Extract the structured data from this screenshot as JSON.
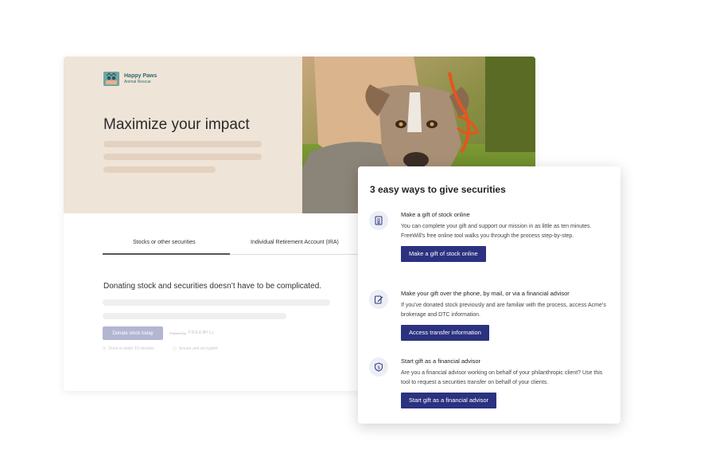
{
  "brand": {
    "name": "Happy Paws",
    "tagline": "Animal Rescue"
  },
  "hero": {
    "title": "Maximize your impact"
  },
  "tabs": [
    {
      "label": "Stocks or other securities",
      "active": true
    },
    {
      "label": "Individual Retirement Account (IRA)",
      "active": false
    }
  ],
  "main": {
    "lead": "Donating stock and securities doesn’t have to be complicated.",
    "donate_label": "Donate stock today",
    "powered_by": "Powered by",
    "powered_brand": "FREEWILL",
    "meta_left": "Done in under 10 minutes",
    "meta_right": "Secure and encrypted"
  },
  "panel": {
    "title": "3 easy ways to give securities",
    "options": [
      {
        "icon": "certificate-icon",
        "heading": "Make a gift of stock online",
        "description": "You can complete your gift and support our mission in as little as ten minutes. FreeWill's free online tool walks you through the process step-by-step.",
        "button": "Make a gift of stock online"
      },
      {
        "icon": "edit-form-icon",
        "heading": "Make your gift over the phone, by mail, or via a financial advisor",
        "description": "If you’ve donated stock previously and are familiar with the process, access Acme’s brokerage and DTC information.",
        "button": "Access transfer information"
      },
      {
        "icon": "shield-dollar-icon",
        "heading": "Start gift as a financial advisor",
        "description": "Are you a financial advisor working on behalf of your philanthropic client? Use this tool to request a securities transfer on behalf of your clients.",
        "button": "Start gift as a financial advisor"
      }
    ]
  },
  "colors": {
    "accent": "#2b3280",
    "hero_bg": "#efe4d8",
    "button_disabled": "#b3b6d3"
  }
}
